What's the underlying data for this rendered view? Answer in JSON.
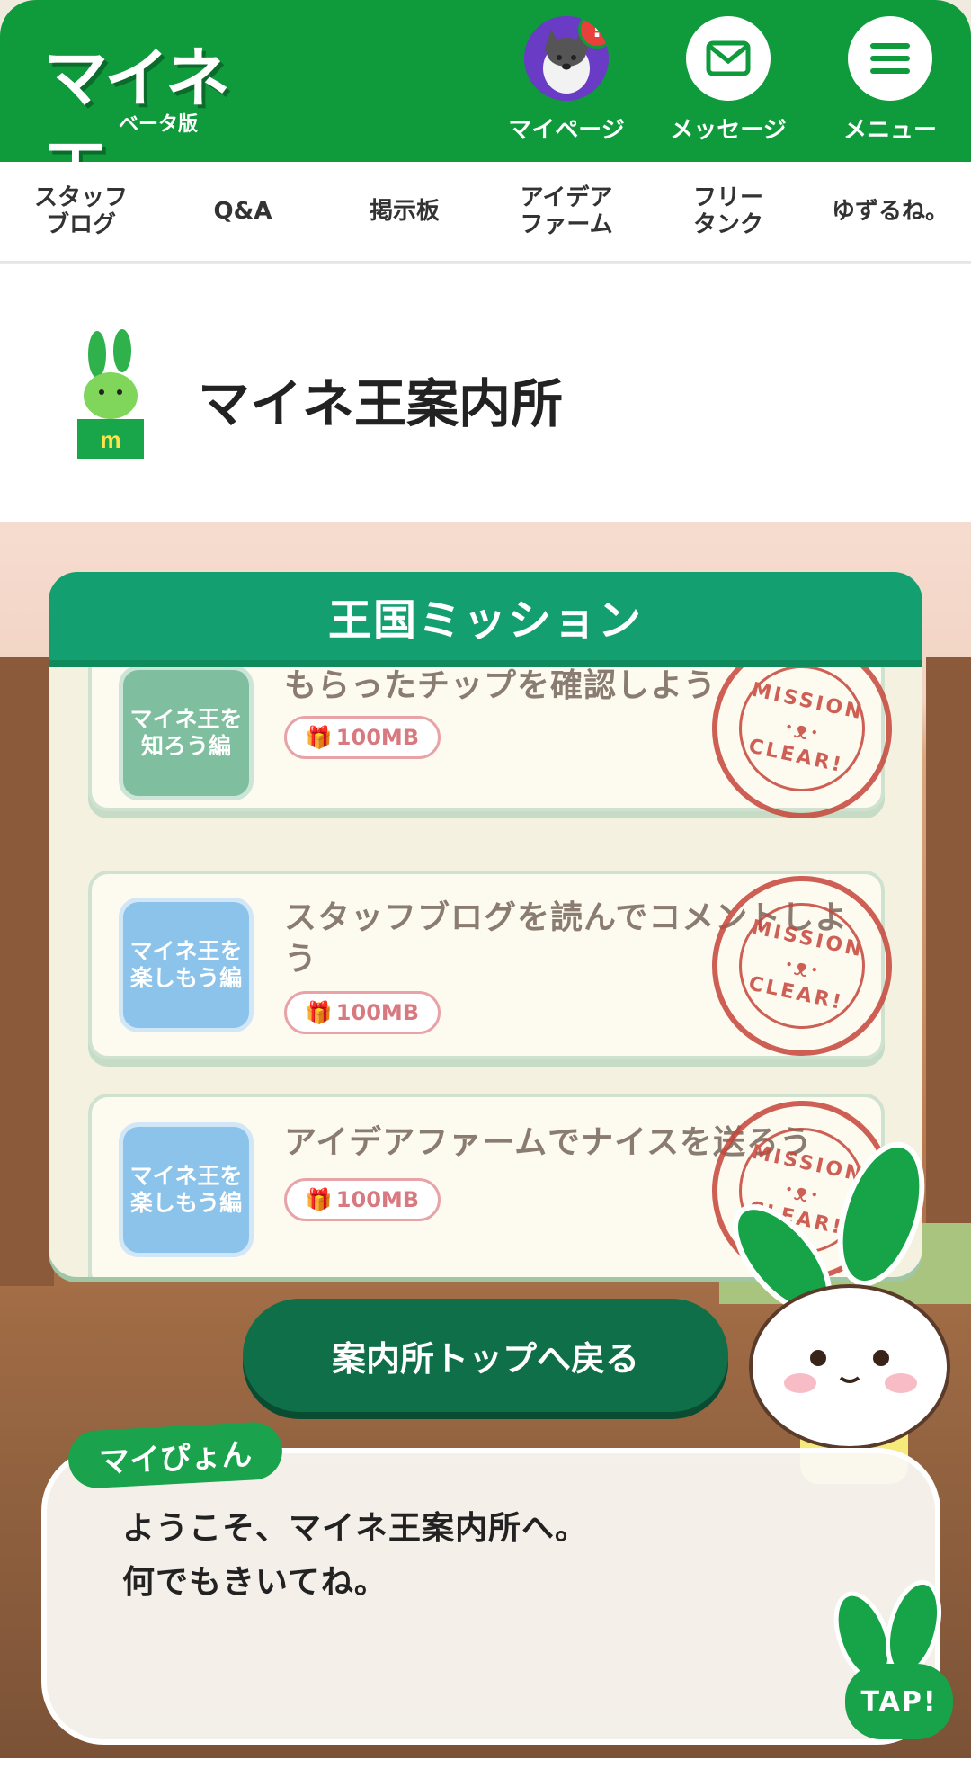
{
  "header": {
    "logo_main": "マイネ王",
    "logo_sub": "ベータ版",
    "badge": "!",
    "buttons": [
      {
        "label": "マイページ"
      },
      {
        "label": "メッセージ"
      },
      {
        "label": "メニュー"
      }
    ]
  },
  "subnav": [
    {
      "label": "スタッフ\nブログ"
    },
    {
      "label": "Q&A"
    },
    {
      "label": "掲示板"
    },
    {
      "label": "アイデア\nファーム"
    },
    {
      "label": "フリー\nタンク"
    },
    {
      "label": "ゆずるね。"
    }
  ],
  "page_title": "マイネ王案内所",
  "mission": {
    "header": "王国ミッション",
    "items": [
      {
        "badge": "マイネ王を\n知ろう編",
        "title": "もらったチップを確認しよう",
        "reward": "100MB"
      },
      {
        "badge": "マイネ王を\n楽しもう編",
        "title": "スタッフブログを読んでコメントしよう",
        "reward": "100MB"
      },
      {
        "badge": "マイネ王を\n楽しもう編",
        "title": "アイデアファームでナイスを送ろう",
        "reward": "100MB"
      }
    ],
    "stamp_top": "MISSION",
    "stamp_bottom": "CLEAR!"
  },
  "back_button": "案内所トップへ戻る",
  "dialog": {
    "speaker": "マイぴょん",
    "line1": "ようこそ、マイネ王案内所へ。",
    "line2": "何でもきいてね。",
    "tap": "TAP!"
  },
  "colors": {
    "brand_green": "#0f9a3c",
    "mission_green": "#149f70",
    "button_green": "#0f6f48",
    "stamp_red": "#c6453a"
  }
}
